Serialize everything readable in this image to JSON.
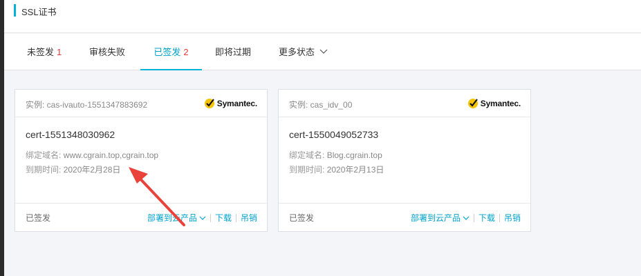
{
  "header": {
    "title": "SSL证书"
  },
  "tabs": [
    {
      "label": "未签发",
      "count": "1"
    },
    {
      "label": "审核失败",
      "count": ""
    },
    {
      "label": "已签发",
      "count": "2"
    },
    {
      "label": "即将过期",
      "count": ""
    },
    {
      "label": "更多状态",
      "count": ""
    }
  ],
  "active_tab": "已签发",
  "cards": [
    {
      "instance_label": "实例: cas-ivauto-1551347883692",
      "brand": "Symantec.",
      "cert_name": "cert-1551348030962",
      "domain_label": "绑定域名:",
      "domain_value": "www.cgrain.top,cgrain.top",
      "expire_label": "到期时间:",
      "expire_value": "2020年2月28日",
      "status": "已签发",
      "deploy_label": "部署到云产品",
      "download_label": "下载",
      "revoke_label": "吊销"
    },
    {
      "instance_label": "实例: cas_idv_00",
      "brand": "Symantec.",
      "cert_name": "cert-1550049052733",
      "domain_label": "绑定域名:",
      "domain_value": "Blog.cgrain.top",
      "expire_label": "到期时间:",
      "expire_value": "2020年2月13日",
      "status": "已签发",
      "deploy_label": "部署到云产品",
      "download_label": "下载",
      "revoke_label": "吊销"
    }
  ],
  "colors": {
    "accent": "#00a2ca",
    "count_red": "#e4393c",
    "arrow_red": "#e8423a",
    "brand_yellow": "#f5c400"
  }
}
